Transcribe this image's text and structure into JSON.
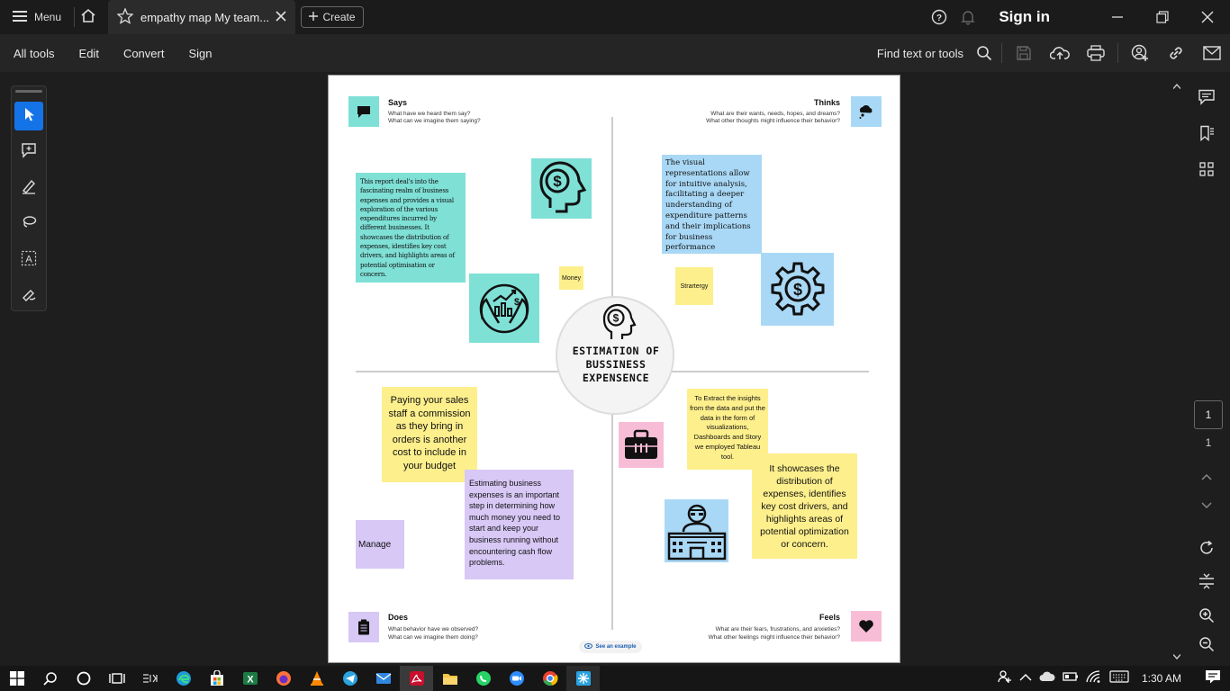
{
  "titlebar": {
    "menu_label": "Menu",
    "tab_title": "empathy map My team...",
    "create_label": "Create",
    "signin_label": "Sign in"
  },
  "toolbar": {
    "all_tools": "All tools",
    "edit": "Edit",
    "convert": "Convert",
    "sign": "Sign",
    "find_label": "Find text or tools"
  },
  "pager": {
    "current": "1",
    "total": "1"
  },
  "doc": {
    "says": {
      "title": "Says",
      "sub1": "What have we heard them say?",
      "sub2": "What can we imagine them saying?"
    },
    "thinks": {
      "title": "Thinks",
      "sub1": "What are their wants, needs, hopes, and dreams?",
      "sub2": "What other thoughts might influence their behavior?"
    },
    "does": {
      "title": "Does",
      "sub1": "What behavior have we observed?",
      "sub2": "What can we imagine them doing?"
    },
    "feels": {
      "title": "Feels",
      "sub1": "What are their fears, frustrations, and anxieties?",
      "sub2": "What other feelings might influence their behavior?"
    },
    "center_title": "ESTIMATION OF BUSSINESS EXPENSENCE",
    "example_label": "See an example",
    "stickies": {
      "says_text": "This report deal's into the fascinating realm of business expenses and provides a visual exploration of the various expenditures incurred by different businesses. It showcases the distribution of expenses, identifies key cost drivers, and highlights areas of potential optimisation or concern.",
      "money": "Money",
      "thinks_text": "The visual representations allow for intuitive analysis, facilitating a deeper understanding of expenditure patterns and their implications for business performance",
      "strategy": "Strartergy",
      "does_sales": "Paying your sales staff a commission as they bring in orders is another cost to include in your budget",
      "does_estimating": "Estimating business expenses is an important step in determining how much money you need to start and keep your business running without encountering cash flow problems.",
      "manage": "Manage",
      "feels_tableau": "To Extract the insights from the data and put the data in the form of visualizations, Dashboards and Story we employed Tableau tool.",
      "feels_showcases": "It showcases the distribution of expenses, identifies key cost drivers, and highlights areas of potential optimization or concern."
    }
  },
  "taskbar": {
    "time": "1:30 AM"
  },
  "colors": {
    "teal": "#7fe0d6",
    "blue": "#a9d8f6",
    "yellow": "#fdef8c",
    "purple": "#d7c8f5",
    "pink": "#f8bdd6",
    "accent": "#1473e6"
  }
}
